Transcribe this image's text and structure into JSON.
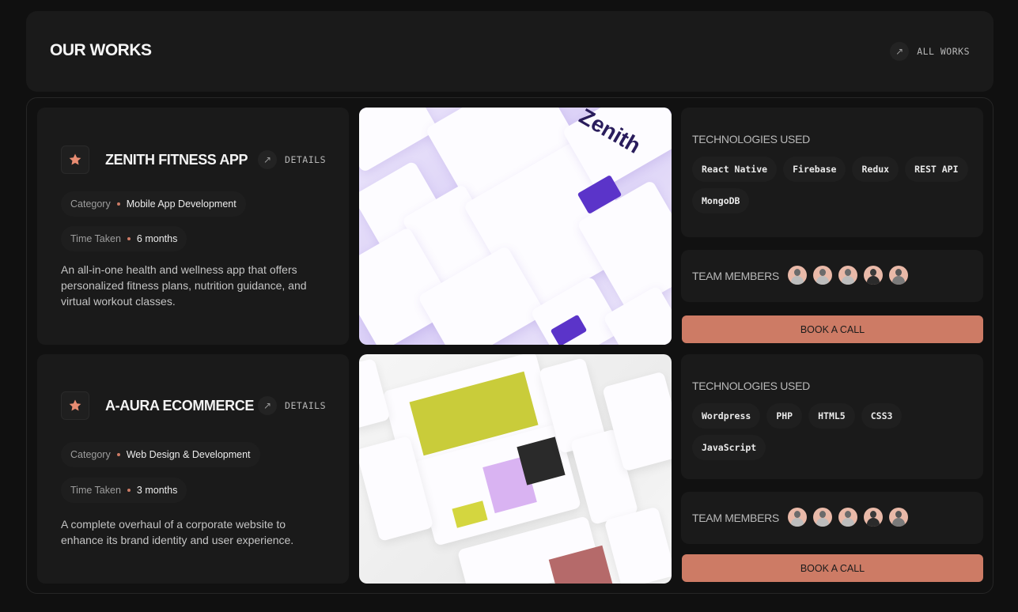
{
  "header": {
    "title": "OUR WORKS",
    "all_works_label": "ALL WORKS",
    "all_works_icon": "arrow-up-right-icon"
  },
  "colors": {
    "background": "#101010",
    "card": "#1a1a1a",
    "accent": "#cd7b65"
  },
  "projects": [
    {
      "name": "ZENITH FITNESS APP",
      "logo_icon": "star-logo-icon",
      "details_label": "DETAILS",
      "category_label": "Category",
      "category": "Mobile App Development",
      "time_label": "Time Taken",
      "time": "6 months",
      "description": "An all-in-one health and wellness app that offers personalized fitness plans, nutrition guidance, and virtual workout classes.",
      "screenshot_alt": "Zenith fitness app UI screens collage",
      "technologies_label": "TECHNOLOGIES USED",
      "technologies": [
        "React Native",
        "Firebase",
        "Redux",
        "REST API",
        "MongoDB"
      ],
      "team_label": "TEAM MEMBERS",
      "team_count": 5,
      "cta_label": "BOOK A CALL"
    },
    {
      "name": "A-AURA ECOMMERCE",
      "logo_icon": "star-logo-icon",
      "details_label": "DETAILS",
      "category_label": "Category",
      "category": "Web Design & Development",
      "time_label": "Time Taken",
      "time": "3 months",
      "description": "A complete overhaul of a corporate website to enhance its brand identity and user experience.",
      "screenshot_alt": "A-Aura ecommerce website UI screens collage",
      "technologies_label": "TECHNOLOGIES USED",
      "technologies": [
        "Wordpress",
        "PHP",
        "HTML5",
        "CSS3",
        "JavaScript"
      ],
      "team_label": "TEAM MEMBERS",
      "team_count": 5,
      "cta_label": "BOOK A CALL"
    }
  ]
}
